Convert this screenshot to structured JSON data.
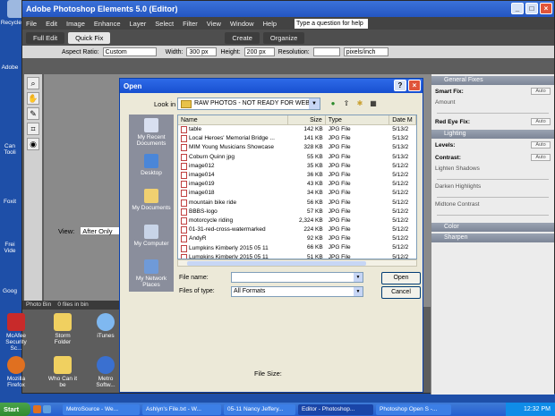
{
  "desktop": {
    "top_icons": [
      "Recycle Bin",
      "",
      "",
      "",
      ""
    ],
    "left_strip": [
      "Adobe",
      "Can Tooli",
      "Foxit",
      "Frei Vide",
      "Goog"
    ],
    "bottom_icons": [
      {
        "label": "McAfee Security Sc..."
      },
      {
        "label": "Storm Folder"
      },
      {
        "label": "iTunes"
      },
      {
        "label": "Mozilla Firefox"
      },
      {
        "label": "Who Can it be"
      },
      {
        "label": "Metro Softw..."
      }
    ]
  },
  "pse": {
    "title": "Adobe Photoshop Elements 5.0 (Editor)",
    "menu": [
      "File",
      "Edit",
      "Image",
      "Enhance",
      "Layer",
      "Select",
      "Filter",
      "View",
      "Window",
      "Help"
    ],
    "help_placeholder": "Type a question for help",
    "modes": {
      "full_edit": "Full Edit",
      "quick_fix": "Quick Fix",
      "create": "Create",
      "organize": "Organize"
    },
    "options": {
      "aspect_label": "Aspect Ratio:",
      "aspect_value": "Custom",
      "width_label": "Width:",
      "width_value": "300 px",
      "height_label": "Height:",
      "height_value": "200 px",
      "resolution_label": "Resolution:",
      "res_unit": "pixels/inch"
    },
    "view_label": "View:",
    "view_value": "After Only",
    "photo_bin": "Photo Bin",
    "photo_bin_count": "0 files in bin",
    "palette": {
      "general_fixes": "General Fixes",
      "smart_fix": "Smart Fix:",
      "amount": "Amount",
      "red_eye": "Red Eye Fix:",
      "auto": "Auto",
      "lighting": "Lighting",
      "levels": "Levels:",
      "contrast": "Contrast:",
      "lighten_shadows": "Lighten Shadows",
      "darken_highlights": "Darken Highlights",
      "midtone_contrast": "Midtone Contrast",
      "color": "Color",
      "sharpen": "Sharpen"
    }
  },
  "dialog": {
    "title": "Open",
    "look_in_label": "Look in",
    "look_in_value": "RAW PHOTOS - NOT READY FOR WEB",
    "places": [
      "My Recent Documents",
      "Desktop",
      "My Documents",
      "My Computer",
      "My Network Places"
    ],
    "columns": {
      "name": "Name",
      "size": "Size",
      "type": "Type",
      "date": "Date M"
    },
    "files": [
      {
        "name": "table",
        "size": "142 KB",
        "type": "JPG File",
        "date": "5/13/2"
      },
      {
        "name": "Local Heroes' Memorial Bridge ...",
        "size": "141 KB",
        "type": "JPG File",
        "date": "5/13/2"
      },
      {
        "name": "MIM Young Musicians Showcase",
        "size": "328 KB",
        "type": "JPG File",
        "date": "5/13/2"
      },
      {
        "name": "Coburn Quinn jpg",
        "size": "55 KB",
        "type": "JPG File",
        "date": "5/13/2"
      },
      {
        "name": "image012",
        "size": "35 KB",
        "type": "JPG File",
        "date": "5/12/2"
      },
      {
        "name": "image014",
        "size": "36 KB",
        "type": "JPG File",
        "date": "5/12/2"
      },
      {
        "name": "image019",
        "size": "43 KB",
        "type": "JPG File",
        "date": "5/12/2"
      },
      {
        "name": "image018",
        "size": "34 KB",
        "type": "JPG File",
        "date": "5/12/2"
      },
      {
        "name": "mountain bike ride",
        "size": "56 KB",
        "type": "JPG File",
        "date": "5/12/2"
      },
      {
        "name": "BBBS-logo",
        "size": "57 KB",
        "type": "JPG File",
        "date": "5/12/2"
      },
      {
        "name": "motorcycle riding",
        "size": "2,324 KB",
        "type": "JPG File",
        "date": "5/12/2"
      },
      {
        "name": "01-31-red-cross-watermarked",
        "size": "224 KB",
        "type": "JPG File",
        "date": "5/12/2"
      },
      {
        "name": "AndyR",
        "size": "92 KB",
        "type": "JPG File",
        "date": "5/12/2"
      },
      {
        "name": "Lumpkins Kimberly 2015 05 11",
        "size": "66 KB",
        "type": "JPG File",
        "date": "5/12/2"
      },
      {
        "name": "Lumpkins Kimberly 2015 05 11",
        "size": "51 KB",
        "type": "JPG File",
        "date": "5/12/2"
      }
    ],
    "file_name_label": "File name:",
    "file_name_value": "",
    "file_type_label": "Files of type:",
    "file_type_value": "All Formats",
    "open_button": "Open",
    "cancel_button": "Cancel",
    "file_size_label": "File Size:"
  },
  "taskbar": {
    "start": "Start",
    "tasks": [
      {
        "label": "MetroSource - We...",
        "active": false
      },
      {
        "label": "Ashlyn's File.txt - W...",
        "active": false
      },
      {
        "label": "05-11 Nancy Jeffery...",
        "active": false
      },
      {
        "label": "Editor - Photoshop...",
        "active": true
      },
      {
        "label": "Photoshop Open S -...",
        "active": false
      }
    ],
    "clock": "12:32 PM"
  }
}
